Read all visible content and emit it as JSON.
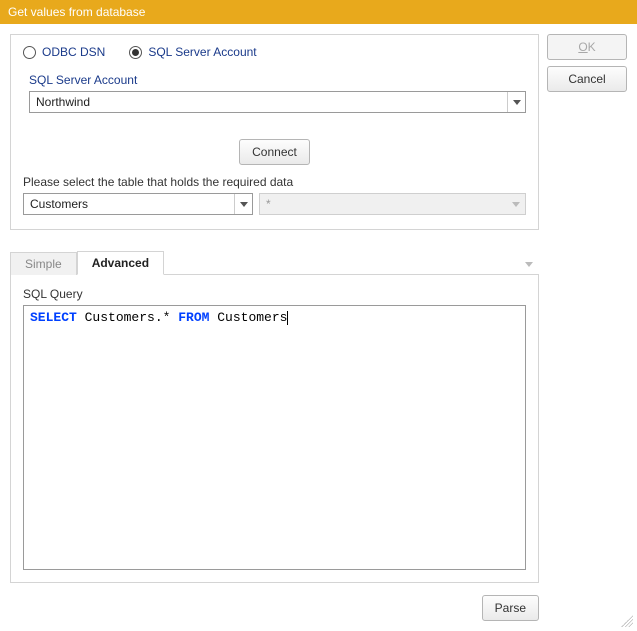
{
  "window": {
    "title": "Get values from database"
  },
  "buttons": {
    "ok": "OK",
    "cancel": "Cancel",
    "connect": "Connect",
    "parse": "Parse"
  },
  "connection": {
    "radio_odbc": "ODBC DSN",
    "radio_sql": "SQL Server Account",
    "selected": "sql",
    "account_label": "SQL Server Account",
    "account_value": "Northwind",
    "table_prompt": "Please select the table that holds the required data",
    "table_value": "Customers",
    "secondary_value": "*"
  },
  "tabs": {
    "simple": "Simple",
    "advanced": "Advanced",
    "active": "advanced"
  },
  "query": {
    "label": "SQL Query",
    "tokens": [
      {
        "t": "kw",
        "v": "SELECT"
      },
      {
        "t": "tx",
        "v": " Customers.* "
      },
      {
        "t": "kw",
        "v": "FROM"
      },
      {
        "t": "tx",
        "v": " Customers"
      }
    ]
  }
}
